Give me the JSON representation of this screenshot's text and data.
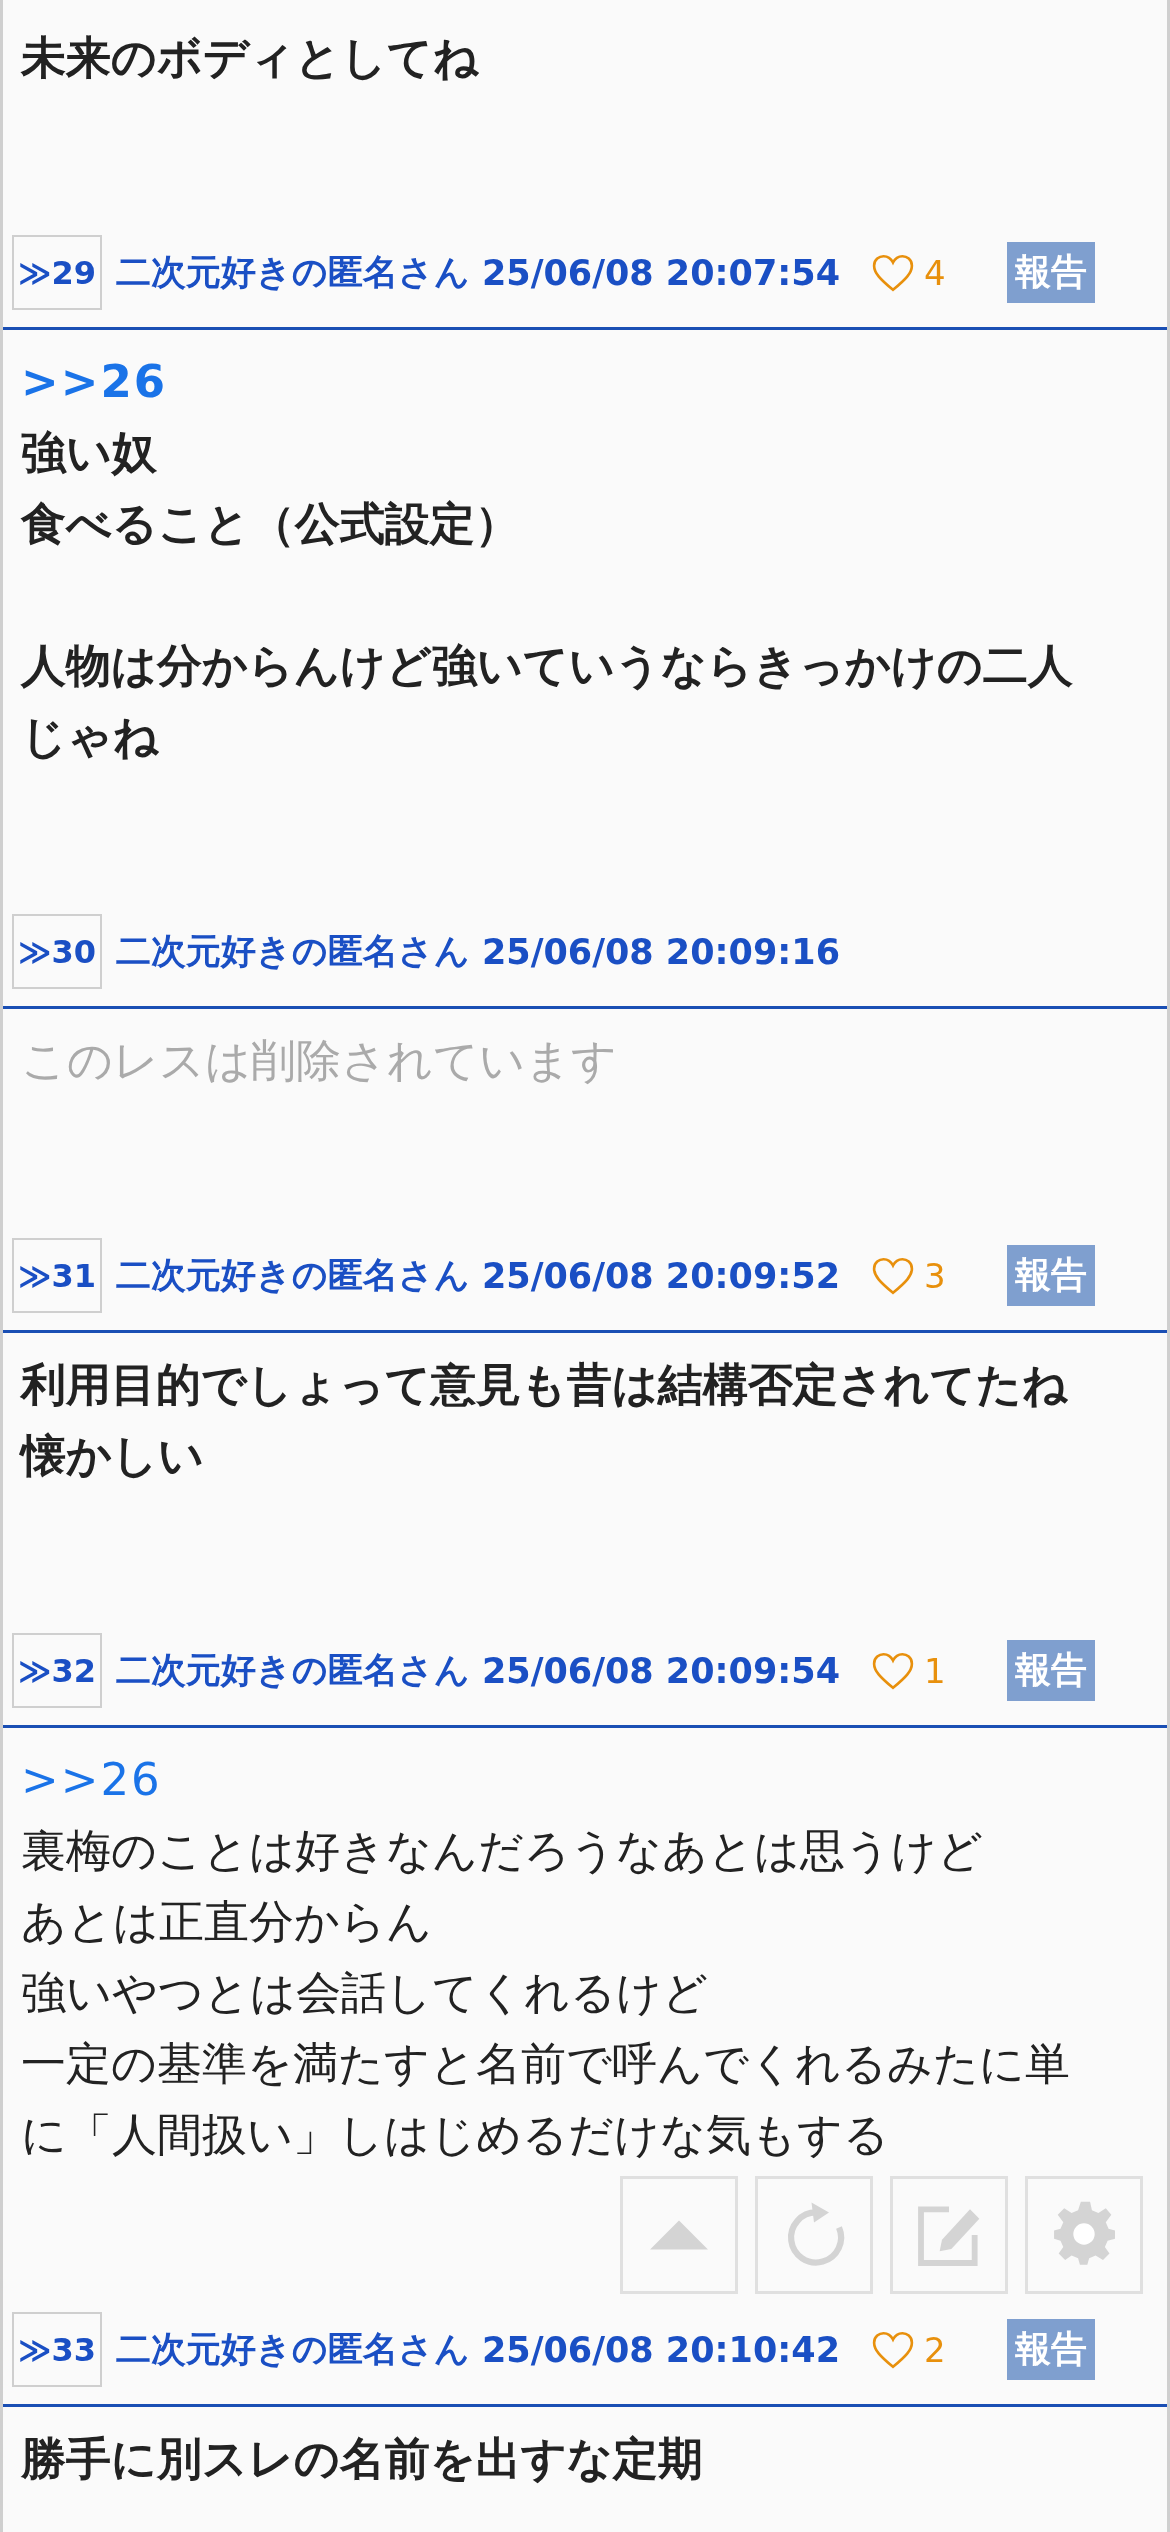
{
  "posts": [
    {
      "kind": "bold",
      "paragraphs": [
        [
          "未来のボディとしてね"
        ]
      ]
    },
    {
      "number": "≫29",
      "name": "二次元好きの匿名さん",
      "date": "25/06/08 20:07:54",
      "likes": "4",
      "report": "報告",
      "kind": "bold",
      "anchor": ">>26",
      "paragraphs": [
        [
          "強い奴",
          "食べること（公式設定）"
        ],
        [
          "人物は分からんけど強いていうならきっかけの二人",
          "じゃね"
        ]
      ]
    },
    {
      "number": "≫30",
      "name": "二次元好きの匿名さん",
      "date": "25/06/08 20:09:16",
      "kind": "deleted",
      "paragraphs": [
        [
          "このレスは削除されています"
        ]
      ]
    },
    {
      "number": "≫31",
      "name": "二次元好きの匿名さん",
      "date": "25/06/08 20:09:52",
      "likes": "3",
      "report": "報告",
      "kind": "bold",
      "paragraphs": [
        [
          "利用目的でしょって意見も昔は結構否定されてたね",
          "懐かしい"
        ]
      ]
    },
    {
      "number": "≫32",
      "name": "二次元好きの匿名さん",
      "date": "25/06/08 20:09:54",
      "likes": "1",
      "report": "報告",
      "kind": "normal",
      "anchor": ">>26",
      "paragraphs": [
        [
          "裏梅のことは好きなんだろうなあとは思うけど",
          "あとは正直分からん",
          "強いやつとは会話してくれるけど",
          "一定の基準を満たすと名前で呼んでくれるみたに単",
          "に「人間扱い」しはじめるだけな気もする"
        ]
      ]
    },
    {
      "number": "≫33",
      "name": "二次元好きの匿名さん",
      "date": "25/06/08 20:10:42",
      "likes": "2",
      "report": "報告",
      "kind": "bold",
      "paragraphs": [
        [
          "勝手に別スレの名前を出すな定期"
        ]
      ]
    }
  ],
  "toolbar": [
    {
      "kind": "top"
    },
    {
      "kind": "reload"
    },
    {
      "kind": "write"
    },
    {
      "kind": "settings"
    }
  ]
}
